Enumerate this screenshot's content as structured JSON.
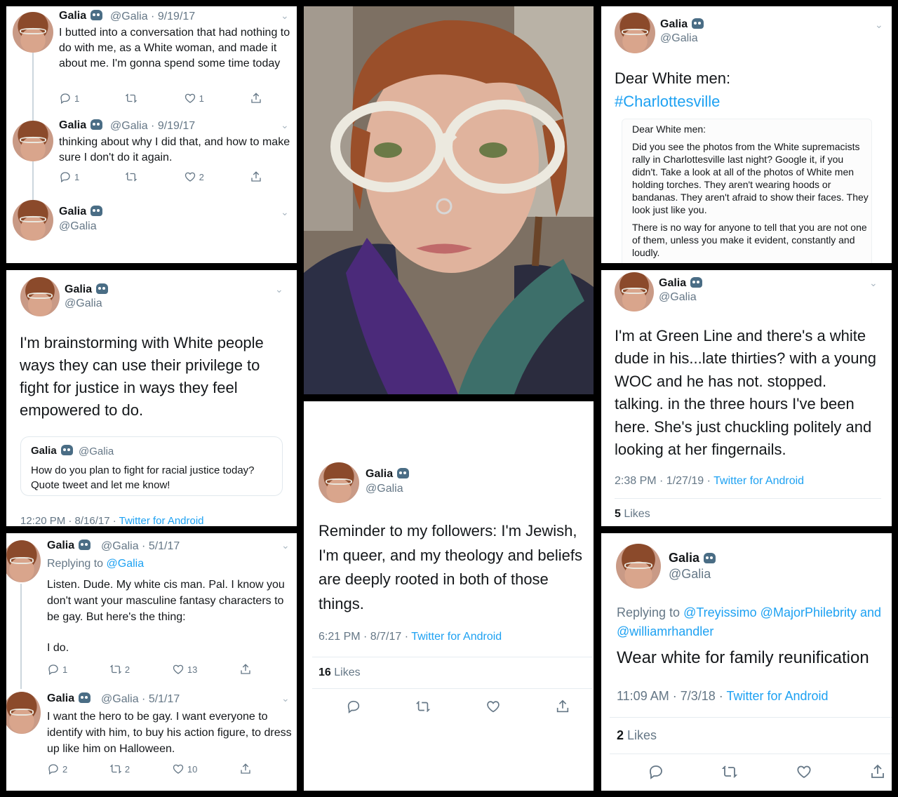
{
  "user": {
    "name": "Galia",
    "handle": "@Galia"
  },
  "p1": {
    "t1": {
      "handle_date": "@Galia · 9/19/17",
      "text": "I butted into a conversation that had nothing to do with me, as a White woman, and made it about me. I'm gonna spend some time today",
      "replies": "1",
      "likes": "1"
    },
    "t2": {
      "handle_date": "@Galia · 9/19/17",
      "text": "thinking about why I did that, and how to make sure I don't do it again.",
      "replies": "1",
      "likes": "2"
    }
  },
  "p2": {
    "text": "Dear White men:",
    "hashtag": "#Charlottesville",
    "img_title": "Dear White men:",
    "img_p1": "Did you see the photos from the White supremacists rally in Charlottesville last night? Google it, if you didn't. Take a look at all of the photos of White men holding torches. They aren't wearing hoods or bandanas. They aren't afraid to show their faces. They look just like you.",
    "img_p2": "There is no way for anyone to tell that you are not one of them, unless you make it evident, constantly and loudly."
  },
  "p3": {
    "text": "I'm brainstorming with White people ways they can use their privilege to fight for justice in ways they feel empowered to do.",
    "quote_text": "How do you plan to fight for racial justice today? Quote tweet and let me know!",
    "time": "12:20 PM · 8/16/17 · ",
    "source": "Twitter for Android"
  },
  "p4": {
    "text": "I'm at Green Line and there's a white dude in his...late thirties? with a young WOC and he has not. stopped. talking. in the three hours I've been here. She's just chuckling politely and looking at her fingernails.",
    "time": "2:38 PM · 1/27/19 · ",
    "source": "Twitter for Android",
    "likes_count": "5",
    "likes_label": " Likes"
  },
  "p5": {
    "t1": {
      "handle_date": "@Galia · 5/1/17",
      "replying_prefix": "Replying to ",
      "replying_handle": "@Galia",
      "text": "Listen. Dude. My white cis man. Pal. I know you don't want your masculine fantasy characters to be gay. But here's the thing:",
      "text2": "I do.",
      "replies": "1",
      "retweets": "2",
      "likes": "13"
    },
    "t2": {
      "handle_date": "@Galia · 5/1/17",
      "text": "I want the hero to be gay. I want everyone to identify with him, to buy his action figure, to dress up like him on Halloween.",
      "replies": "2",
      "retweets": "2",
      "likes": "10"
    }
  },
  "p6": {
    "text": "Reminder to my followers: I'm Jewish, I'm queer, and my theology and beliefs are deeply rooted in both of those things.",
    "time": "6:21 PM · 8/7/17 · ",
    "source": "Twitter for Android",
    "likes_count": "16",
    "likes_label": " Likes"
  },
  "p7": {
    "replying_prefix": "Replying to ",
    "replying_handles": "@Treyissimo @MajorPhilebrity and",
    "replying_handle2": "@williamrhandler",
    "text": "Wear white for family reunification",
    "time": "11:09 AM · 7/3/18 · ",
    "source": "Twitter for Android",
    "likes_count": "2",
    "likes_label": " Likes"
  },
  "colors": {
    "link": "#1da1f2",
    "meta": "#657786",
    "text": "#14171a"
  },
  "icons": [
    "reply-icon",
    "retweet-icon",
    "like-icon",
    "share-icon",
    "chevron-down-icon",
    "avatar",
    "verified-badge"
  ]
}
